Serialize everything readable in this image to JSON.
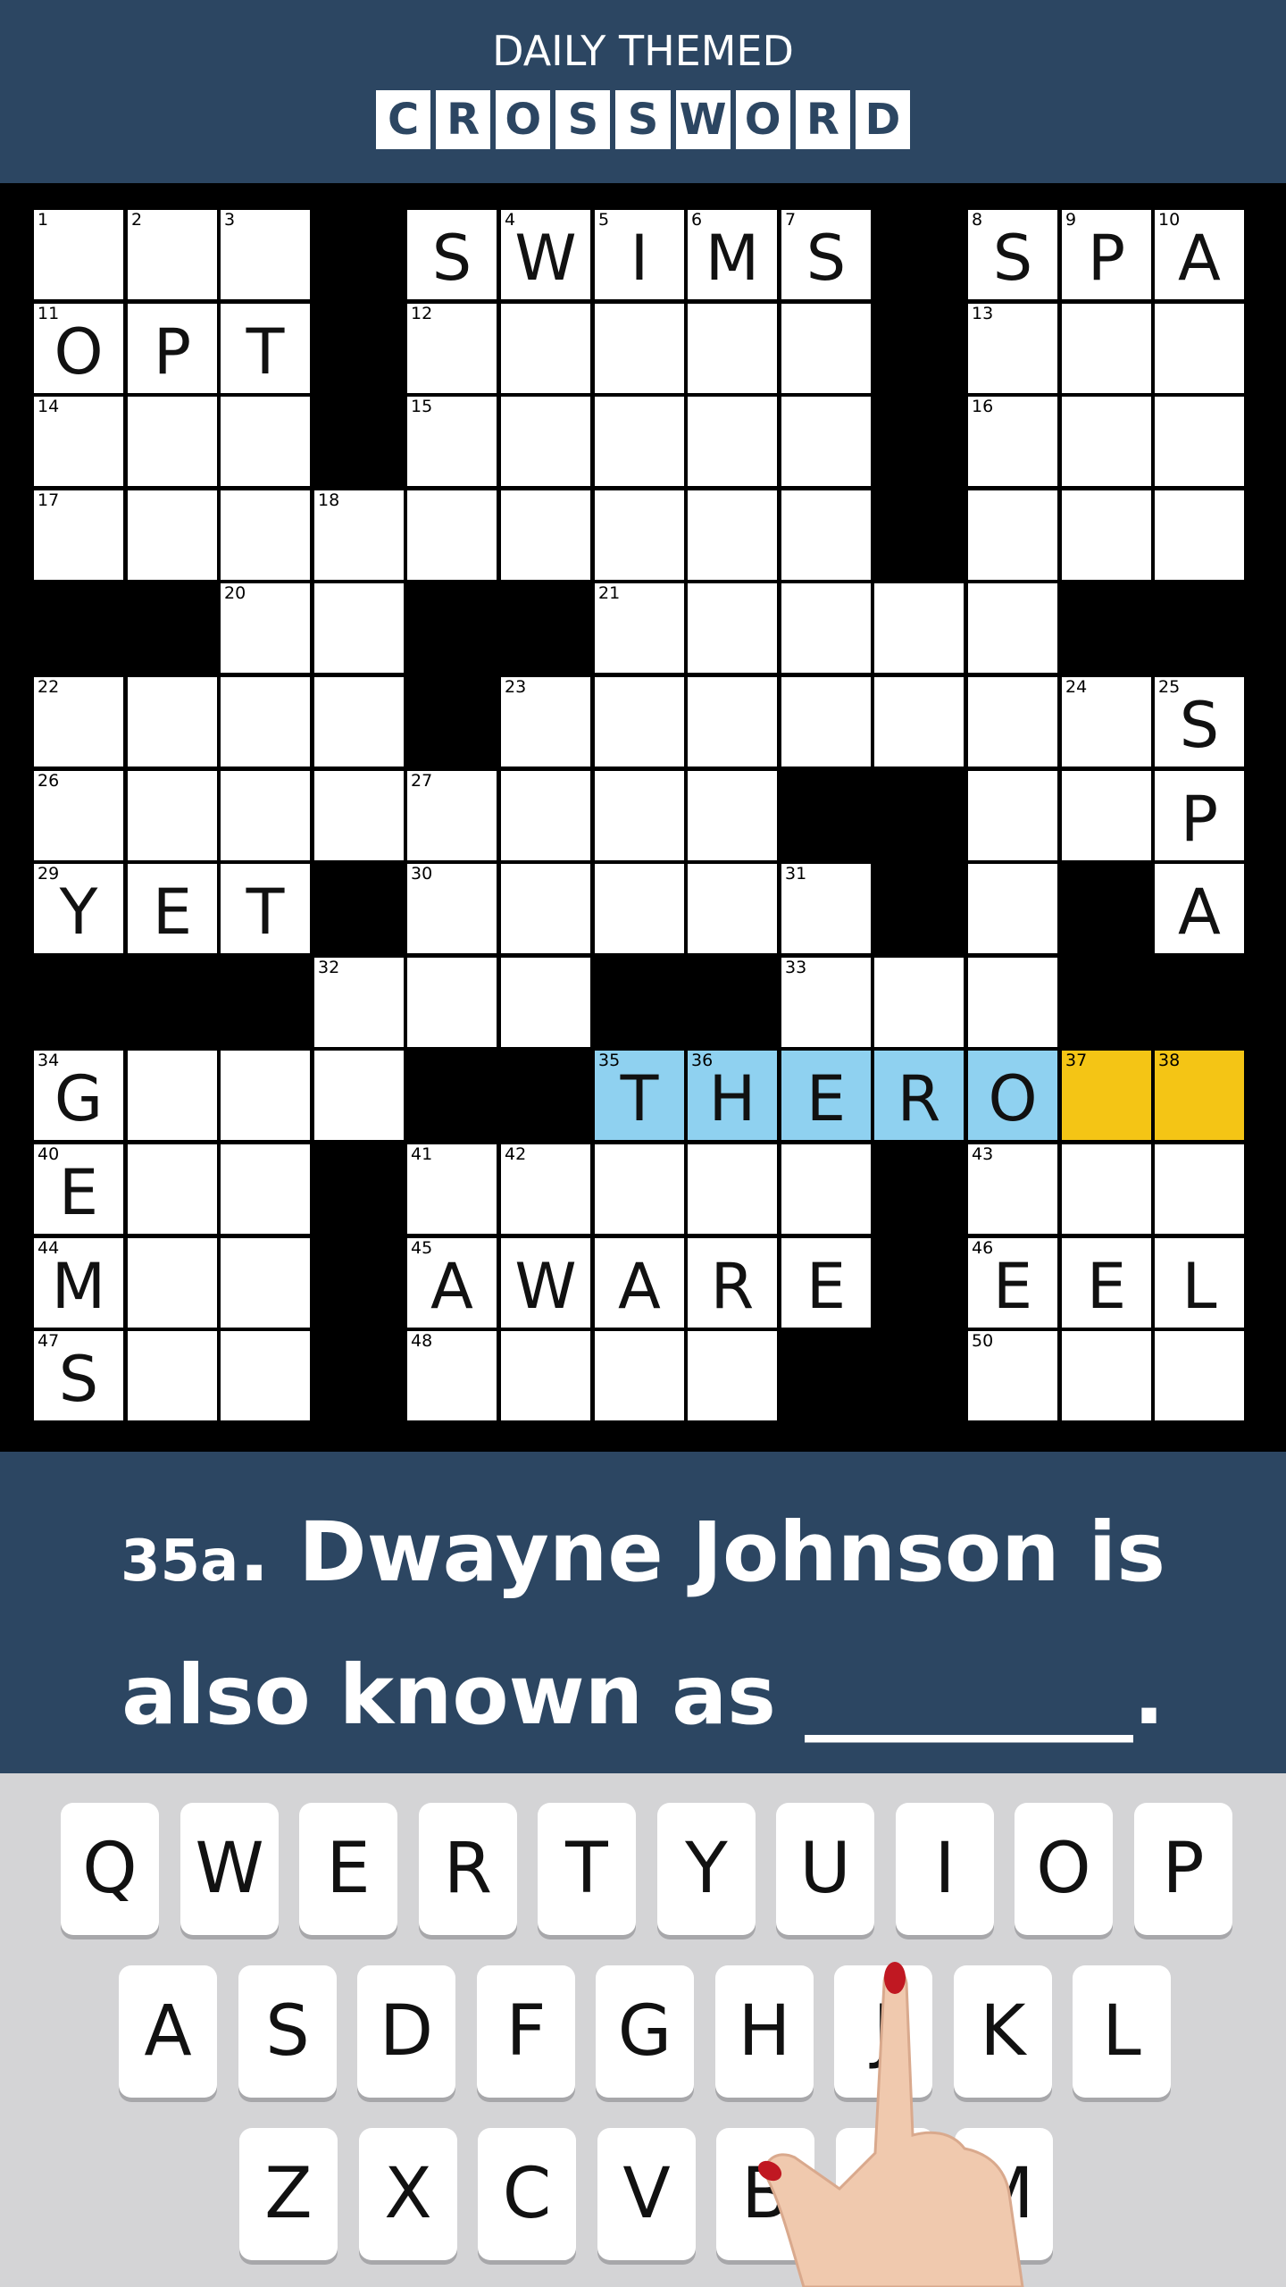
{
  "header": {
    "subtitle": "DAILY THEMED",
    "title_letters": [
      "C",
      "R",
      "O",
      "S",
      "S",
      "W",
      "O",
      "R",
      "D"
    ]
  },
  "grid": {
    "rows": 13,
    "cols": 13,
    "cells": [
      {
        "r": 0,
        "c": 0,
        "n": "1",
        "l": ""
      },
      {
        "r": 0,
        "c": 1,
        "n": "2",
        "l": ""
      },
      {
        "r": 0,
        "c": 2,
        "n": "3",
        "l": ""
      },
      {
        "r": 0,
        "c": 4,
        "n": "",
        "l": "S"
      },
      {
        "r": 0,
        "c": 5,
        "n": "4",
        "l": "W"
      },
      {
        "r": 0,
        "c": 6,
        "n": "5",
        "l": "I"
      },
      {
        "r": 0,
        "c": 7,
        "n": "6",
        "l": "M"
      },
      {
        "r": 0,
        "c": 8,
        "n": "7",
        "l": "S"
      },
      {
        "r": 0,
        "c": 10,
        "n": "8",
        "l": "S"
      },
      {
        "r": 0,
        "c": 11,
        "n": "9",
        "l": "P"
      },
      {
        "r": 0,
        "c": 12,
        "n": "10",
        "l": "A"
      },
      {
        "r": 1,
        "c": 0,
        "n": "11",
        "l": "O"
      },
      {
        "r": 1,
        "c": 1,
        "n": "",
        "l": "P"
      },
      {
        "r": 1,
        "c": 2,
        "n": "",
        "l": "T"
      },
      {
        "r": 1,
        "c": 4,
        "n": "12",
        "l": ""
      },
      {
        "r": 1,
        "c": 5,
        "n": "",
        "l": ""
      },
      {
        "r": 1,
        "c": 6,
        "n": "",
        "l": ""
      },
      {
        "r": 1,
        "c": 7,
        "n": "",
        "l": ""
      },
      {
        "r": 1,
        "c": 8,
        "n": "",
        "l": ""
      },
      {
        "r": 1,
        "c": 10,
        "n": "13",
        "l": ""
      },
      {
        "r": 1,
        "c": 11,
        "n": "",
        "l": ""
      },
      {
        "r": 1,
        "c": 12,
        "n": "",
        "l": ""
      },
      {
        "r": 2,
        "c": 0,
        "n": "14",
        "l": ""
      },
      {
        "r": 2,
        "c": 1,
        "n": "",
        "l": ""
      },
      {
        "r": 2,
        "c": 2,
        "n": "",
        "l": ""
      },
      {
        "r": 2,
        "c": 4,
        "n": "15",
        "l": ""
      },
      {
        "r": 2,
        "c": 5,
        "n": "",
        "l": ""
      },
      {
        "r": 2,
        "c": 6,
        "n": "",
        "l": ""
      },
      {
        "r": 2,
        "c": 7,
        "n": "",
        "l": ""
      },
      {
        "r": 2,
        "c": 8,
        "n": "",
        "l": ""
      },
      {
        "r": 2,
        "c": 10,
        "n": "16",
        "l": ""
      },
      {
        "r": 2,
        "c": 11,
        "n": "",
        "l": ""
      },
      {
        "r": 2,
        "c": 12,
        "n": "",
        "l": ""
      },
      {
        "r": 3,
        "c": 0,
        "n": "17",
        "l": ""
      },
      {
        "r": 3,
        "c": 1,
        "n": "",
        "l": ""
      },
      {
        "r": 3,
        "c": 2,
        "n": "",
        "l": ""
      },
      {
        "r": 3,
        "c": 3,
        "n": "18",
        "l": ""
      },
      {
        "r": 3,
        "c": 4,
        "n": "",
        "l": ""
      },
      {
        "r": 3,
        "c": 5,
        "n": "",
        "l": ""
      },
      {
        "r": 3,
        "c": 6,
        "n": "",
        "l": ""
      },
      {
        "r": 3,
        "c": 7,
        "n": "",
        "l": ""
      },
      {
        "r": 3,
        "c": 8,
        "n": "",
        "l": ""
      },
      {
        "r": 3,
        "c": 10,
        "n": "",
        "l": ""
      },
      {
        "r": 3,
        "c": 11,
        "n": "",
        "l": ""
      },
      {
        "r": 3,
        "c": 12,
        "n": "",
        "l": ""
      },
      {
        "r": 4,
        "c": 2,
        "n": "20",
        "l": ""
      },
      {
        "r": 4,
        "c": 3,
        "n": "",
        "l": ""
      },
      {
        "r": 4,
        "c": 6,
        "n": "21",
        "l": ""
      },
      {
        "r": 4,
        "c": 7,
        "n": "",
        "l": ""
      },
      {
        "r": 4,
        "c": 8,
        "n": "",
        "l": ""
      },
      {
        "r": 4,
        "c": 9,
        "n": "",
        "l": ""
      },
      {
        "r": 4,
        "c": 10,
        "n": "",
        "l": ""
      },
      {
        "r": 5,
        "c": 0,
        "n": "22",
        "l": ""
      },
      {
        "r": 5,
        "c": 1,
        "n": "",
        "l": ""
      },
      {
        "r": 5,
        "c": 2,
        "n": "",
        "l": ""
      },
      {
        "r": 5,
        "c": 3,
        "n": "",
        "l": ""
      },
      {
        "r": 5,
        "c": 5,
        "n": "23",
        "l": ""
      },
      {
        "r": 5,
        "c": 6,
        "n": "",
        "l": ""
      },
      {
        "r": 5,
        "c": 7,
        "n": "",
        "l": ""
      },
      {
        "r": 5,
        "c": 8,
        "n": "",
        "l": ""
      },
      {
        "r": 5,
        "c": 9,
        "n": "",
        "l": ""
      },
      {
        "r": 5,
        "c": 10,
        "n": "",
        "l": ""
      },
      {
        "r": 5,
        "c": 11,
        "n": "24",
        "l": ""
      },
      {
        "r": 5,
        "c": 12,
        "n": "25",
        "l": "S"
      },
      {
        "r": 6,
        "c": 0,
        "n": "26",
        "l": ""
      },
      {
        "r": 6,
        "c": 1,
        "n": "",
        "l": ""
      },
      {
        "r": 6,
        "c": 2,
        "n": "",
        "l": ""
      },
      {
        "r": 6,
        "c": 3,
        "n": "",
        "l": ""
      },
      {
        "r": 6,
        "c": 4,
        "n": "27",
        "l": ""
      },
      {
        "r": 6,
        "c": 5,
        "n": "",
        "l": ""
      },
      {
        "r": 6,
        "c": 6,
        "n": "",
        "l": ""
      },
      {
        "r": 6,
        "c": 7,
        "n": "",
        "l": ""
      },
      {
        "r": 6,
        "c": 10,
        "n": "",
        "l": ""
      },
      {
        "r": 6,
        "c": 11,
        "n": "",
        "l": ""
      },
      {
        "r": 6,
        "c": 12,
        "n": "",
        "l": "P"
      },
      {
        "r": 7,
        "c": 0,
        "n": "29",
        "l": "Y"
      },
      {
        "r": 7,
        "c": 1,
        "n": "",
        "l": "E"
      },
      {
        "r": 7,
        "c": 2,
        "n": "",
        "l": "T"
      },
      {
        "r": 7,
        "c": 4,
        "n": "30",
        "l": ""
      },
      {
        "r": 7,
        "c": 5,
        "n": "",
        "l": ""
      },
      {
        "r": 7,
        "c": 6,
        "n": "",
        "l": ""
      },
      {
        "r": 7,
        "c": 7,
        "n": "",
        "l": ""
      },
      {
        "r": 7,
        "c": 8,
        "n": "31",
        "l": ""
      },
      {
        "r": 7,
        "c": 10,
        "n": "",
        "l": ""
      },
      {
        "r": 7,
        "c": 12,
        "n": "",
        "l": "A"
      },
      {
        "r": 8,
        "c": 3,
        "n": "32",
        "l": ""
      },
      {
        "r": 8,
        "c": 4,
        "n": "",
        "l": ""
      },
      {
        "r": 8,
        "c": 5,
        "n": "",
        "l": ""
      },
      {
        "r": 8,
        "c": 8,
        "n": "33",
        "l": ""
      },
      {
        "r": 8,
        "c": 9,
        "n": "",
        "l": ""
      },
      {
        "r": 8,
        "c": 10,
        "n": "",
        "l": ""
      },
      {
        "r": 9,
        "c": 0,
        "n": "34",
        "l": "G"
      },
      {
        "r": 9,
        "c": 1,
        "n": "",
        "l": ""
      },
      {
        "r": 9,
        "c": 2,
        "n": "",
        "l": ""
      },
      {
        "r": 9,
        "c": 3,
        "n": "",
        "l": ""
      },
      {
        "r": 9,
        "c": 6,
        "n": "35",
        "l": "T",
        "s": "hl"
      },
      {
        "r": 9,
        "c": 7,
        "n": "36",
        "l": "H",
        "s": "hl"
      },
      {
        "r": 9,
        "c": 8,
        "n": "",
        "l": "E",
        "s": "hl"
      },
      {
        "r": 9,
        "c": 9,
        "n": "",
        "l": "R",
        "s": "hl"
      },
      {
        "r": 9,
        "c": 10,
        "n": "",
        "l": "O",
        "s": "hl"
      },
      {
        "r": 9,
        "c": 11,
        "n": "37",
        "l": "",
        "s": "cur"
      },
      {
        "r": 9,
        "c": 12,
        "n": "38",
        "l": "",
        "s": "cur"
      },
      {
        "r": 10,
        "c": 0,
        "n": "40",
        "l": "E"
      },
      {
        "r": 10,
        "c": 1,
        "n": "",
        "l": ""
      },
      {
        "r": 10,
        "c": 2,
        "n": "",
        "l": ""
      },
      {
        "r": 10,
        "c": 4,
        "n": "41",
        "l": ""
      },
      {
        "r": 10,
        "c": 5,
        "n": "42",
        "l": ""
      },
      {
        "r": 10,
        "c": 6,
        "n": "",
        "l": ""
      },
      {
        "r": 10,
        "c": 7,
        "n": "",
        "l": ""
      },
      {
        "r": 10,
        "c": 8,
        "n": "",
        "l": ""
      },
      {
        "r": 10,
        "c": 10,
        "n": "43",
        "l": ""
      },
      {
        "r": 10,
        "c": 11,
        "n": "",
        "l": ""
      },
      {
        "r": 10,
        "c": 12,
        "n": "",
        "l": ""
      },
      {
        "r": 11,
        "c": 0,
        "n": "44",
        "l": "M"
      },
      {
        "r": 11,
        "c": 1,
        "n": "",
        "l": ""
      },
      {
        "r": 11,
        "c": 2,
        "n": "",
        "l": ""
      },
      {
        "r": 11,
        "c": 4,
        "n": "45",
        "l": "A"
      },
      {
        "r": 11,
        "c": 5,
        "n": "",
        "l": "W"
      },
      {
        "r": 11,
        "c": 6,
        "n": "",
        "l": "A"
      },
      {
        "r": 11,
        "c": 7,
        "n": "",
        "l": "R"
      },
      {
        "r": 11,
        "c": 8,
        "n": "",
        "l": "E"
      },
      {
        "r": 11,
        "c": 10,
        "n": "46",
        "l": "E"
      },
      {
        "r": 11,
        "c": 11,
        "n": "",
        "l": "E"
      },
      {
        "r": 11,
        "c": 12,
        "n": "",
        "l": "L"
      },
      {
        "r": 12,
        "c": 0,
        "n": "47",
        "l": "S"
      },
      {
        "r": 12,
        "c": 1,
        "n": "",
        "l": ""
      },
      {
        "r": 12,
        "c": 2,
        "n": "",
        "l": ""
      },
      {
        "r": 12,
        "c": 4,
        "n": "48",
        "l": ""
      },
      {
        "r": 12,
        "c": 5,
        "n": "",
        "l": ""
      },
      {
        "r": 12,
        "c": 6,
        "n": "",
        "l": ""
      },
      {
        "r": 12,
        "c": 7,
        "n": "",
        "l": ""
      },
      {
        "r": 12,
        "c": 10,
        "n": "50",
        "l": ""
      },
      {
        "r": 12,
        "c": 11,
        "n": "",
        "l": ""
      },
      {
        "r": 12,
        "c": 12,
        "n": "",
        "l": ""
      }
    ]
  },
  "clue": {
    "ref": "35a",
    "text": ". Dwayne Johnson is also known as ________."
  },
  "keyboard": {
    "rows": [
      [
        "Q",
        "W",
        "E",
        "R",
        "T",
        "Y",
        "U",
        "I",
        "O",
        "P"
      ],
      [
        "A",
        "S",
        "D",
        "F",
        "G",
        "H",
        "J",
        "K",
        "L"
      ],
      [
        "Z",
        "X",
        "C",
        "V",
        "B",
        "N",
        "M"
      ]
    ]
  },
  "colors": {
    "header_bg": "#2c4662",
    "highlight": "#8fd1f0",
    "current_cell": "#f4c515",
    "keyboard_bg": "#d4d4d6"
  }
}
